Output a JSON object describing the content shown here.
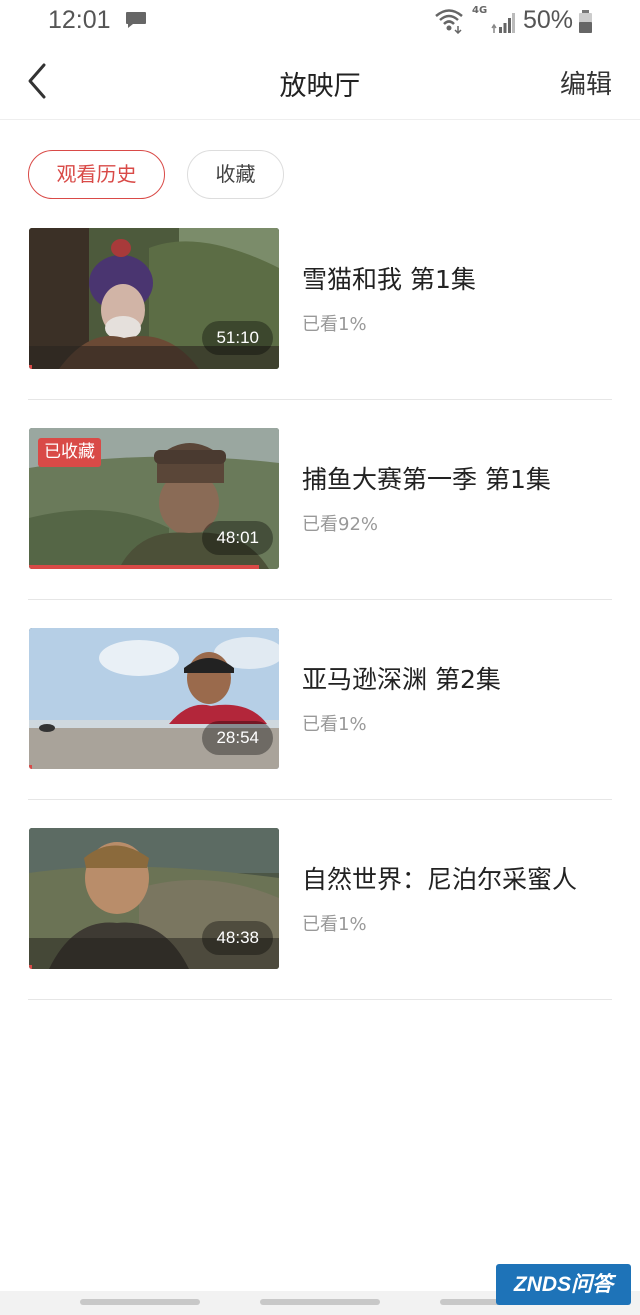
{
  "status_bar": {
    "time": "12:01",
    "network": "4G",
    "battery": "50%"
  },
  "header": {
    "title": "放映厅",
    "edit_label": "编辑"
  },
  "tabs": [
    {
      "label": "观看历史",
      "active": true
    },
    {
      "label": "收藏",
      "active": false
    }
  ],
  "videos": [
    {
      "title": "雪猫和我 第1集",
      "duration": "51:10",
      "watched": "已看1%",
      "watched_fraction": 0.01,
      "favorited": false
    },
    {
      "title": "捕鱼大赛第一季 第1集",
      "duration": "48:01",
      "watched": "已看92%",
      "watched_fraction": 0.92,
      "favorited": true,
      "badge": "已收藏"
    },
    {
      "title": "亚马逊深渊 第2集",
      "duration": "28:54",
      "watched": "已看1%",
      "watched_fraction": 0.01,
      "favorited": false
    },
    {
      "title": "自然世界：尼泊尔采蜜人",
      "duration": "48:38",
      "watched": "已看1%",
      "watched_fraction": 0.01,
      "favorited": false
    }
  ],
  "watermark": "ZNDS问答",
  "colors": {
    "accent": "#d94a47",
    "watermark_bg": "#1e73b8"
  }
}
